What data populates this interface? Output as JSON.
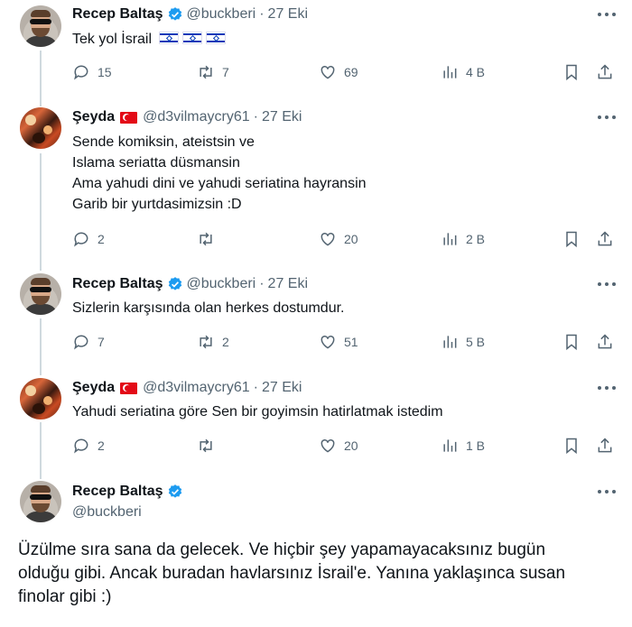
{
  "tweets": [
    {
      "name": "Recep Baltaş",
      "handle": "@buckberi",
      "date": "27 Eki",
      "lines": [
        "Tek yol İsrail"
      ],
      "flag_suffix": "israel-flag x3",
      "replies": "15",
      "retweets": "7",
      "likes": "69",
      "views": "4 B"
    },
    {
      "name": "Şeyda",
      "handle": "@d3vilmaycry61",
      "date": "27 Eki",
      "lines": [
        "Sende komiksin, ateistsin ve",
        "Islama seriatta düsmansin",
        "Ama yahudi dini ve yahudi seriatina hayransin",
        "Garib bir yurtdasimizsin :D"
      ],
      "replies": "2",
      "retweets": "",
      "likes": "20",
      "views": "2 B"
    },
    {
      "name": "Recep Baltaş",
      "handle": "@buckberi",
      "date": "27 Eki",
      "lines": [
        "Sizlerin karşısında olan herkes dostumdur."
      ],
      "replies": "7",
      "retweets": "2",
      "likes": "51",
      "views": "5 B"
    },
    {
      "name": "Şeyda",
      "handle": "@d3vilmaycry61",
      "date": "27 Eki",
      "lines": [
        "Yahudi seriatina göre Sen bir goyimsin hatirlatmak istedim"
      ],
      "replies": "2",
      "retweets": "",
      "likes": "20",
      "views": "1 B"
    }
  ],
  "main_tweet": {
    "name": "Recep Baltaş",
    "handle": "@buckberi",
    "lines": [
      "Üzülme sıra sana da gelecek. Ve hiçbir şey yapamayacaksınız bugün",
      "olduğu gibi. Ancak buradan havlarsınız İsrail'e. Yanına yaklaşınca susan",
      "finolar gibi :)"
    ]
  },
  "colors": {
    "verified": "#1d9bf0",
    "muted": "#536471",
    "thread_line": "#cfd9de",
    "turkey_flag": "#e30a17",
    "israel_blue": "#0038b8"
  }
}
